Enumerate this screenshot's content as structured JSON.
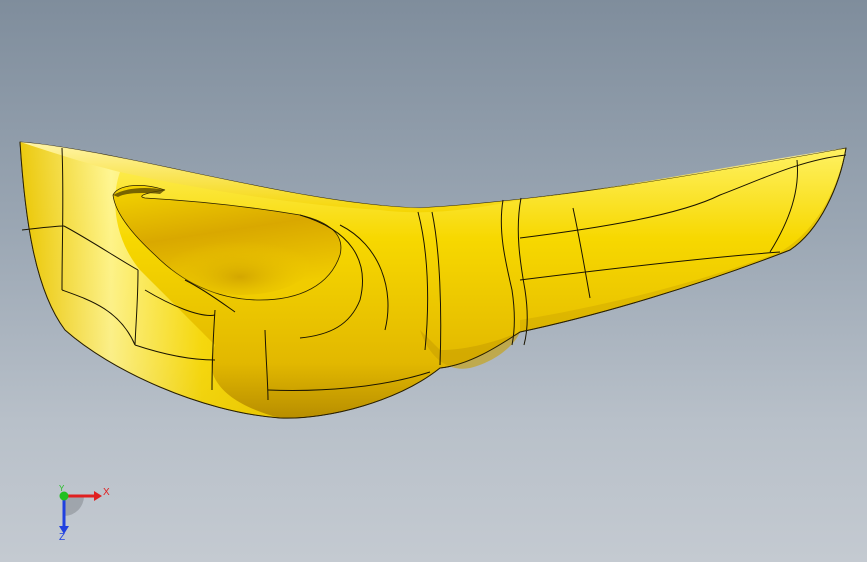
{
  "viewport": {
    "background_top": "#7f8d9c",
    "background_bottom": "#c4cad1"
  },
  "model": {
    "face_color": "#f5d400",
    "edge_color": "#1a1400"
  },
  "triad": {
    "x_label": "X",
    "y_label": "Y",
    "z_label": "Z",
    "x_color": "#e02020",
    "y_color": "#20c020",
    "z_color": "#2040e0"
  }
}
